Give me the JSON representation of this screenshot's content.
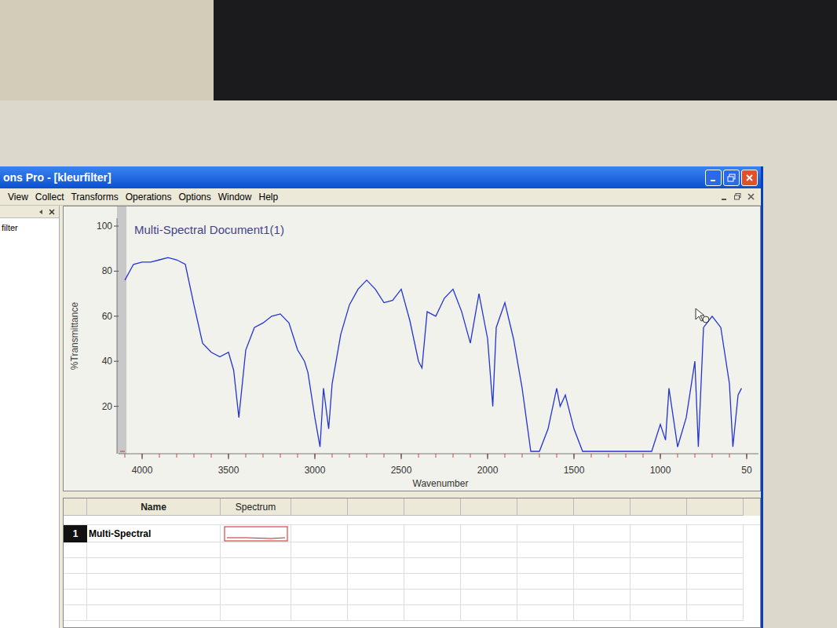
{
  "window": {
    "title": "ons Pro - [kleurfilter]"
  },
  "menu": [
    {
      "label": "View"
    },
    {
      "label": "Collect"
    },
    {
      "label": "Transforms"
    },
    {
      "label": "Operations"
    },
    {
      "label": "Options"
    },
    {
      "label": "Window"
    },
    {
      "label": "Help"
    }
  ],
  "sidebar": {
    "items": [
      {
        "label": "filter",
        "selected": false
      }
    ]
  },
  "chart": {
    "title": "Multi-Spectral Document1(1)",
    "y_axis": {
      "label": "%Transmittance",
      "ticks": [
        "100",
        "80",
        "60",
        "40",
        "20"
      ]
    },
    "x_axis": {
      "label": "Wavenumber",
      "ticks": [
        "4000",
        "3500",
        "3000",
        "2500",
        "2000",
        "1500",
        "1000",
        "50"
      ]
    },
    "series": [
      {
        "name": "Multi-Spectral",
        "color": "#2433d6",
        "wavenumbers": [
          4100,
          4050,
          4000,
          3950,
          3900,
          3850,
          3800,
          3750,
          3700,
          3650,
          3600,
          3550,
          3500,
          3470,
          3440,
          3400,
          3350,
          3300,
          3250,
          3200,
          3150,
          3100,
          3060,
          3040,
          3000,
          2970,
          2950,
          2920,
          2900,
          2850,
          2800,
          2750,
          2700,
          2650,
          2600,
          2550,
          2500,
          2450,
          2400,
          2380,
          2350,
          2300,
          2250,
          2200,
          2150,
          2100,
          2050,
          2000,
          1970,
          1950,
          1900,
          1850,
          1800,
          1750,
          1700,
          1650,
          1600,
          1580,
          1550,
          1500,
          1450,
          1400,
          1300,
          1200,
          1100,
          1050,
          1000,
          970,
          950,
          900,
          850,
          800,
          780,
          750,
          700,
          650,
          600,
          580,
          550,
          530
        ],
        "values": [
          76,
          83,
          84,
          84,
          85,
          86,
          85,
          83,
          65,
          48,
          44,
          42,
          44,
          36,
          15,
          45,
          55,
          57,
          60,
          61,
          57,
          45,
          40,
          35,
          15,
          2,
          28,
          10,
          30,
          52,
          65,
          72,
          76,
          72,
          66,
          67,
          72,
          58,
          40,
          37,
          62,
          60,
          68,
          72,
          62,
          48,
          70,
          50,
          20,
          55,
          66,
          50,
          28,
          0,
          0,
          10,
          28,
          20,
          25,
          10,
          0,
          0,
          0,
          0,
          0,
          0,
          12,
          5,
          28,
          2,
          15,
          40,
          2,
          55,
          60,
          55,
          30,
          2,
          25,
          28
        ]
      }
    ]
  },
  "table": {
    "columns": [
      "Name",
      "Spectrum"
    ],
    "rows": [
      {
        "index": "1",
        "name": "Multi-Spectral",
        "selected": false
      }
    ]
  }
}
